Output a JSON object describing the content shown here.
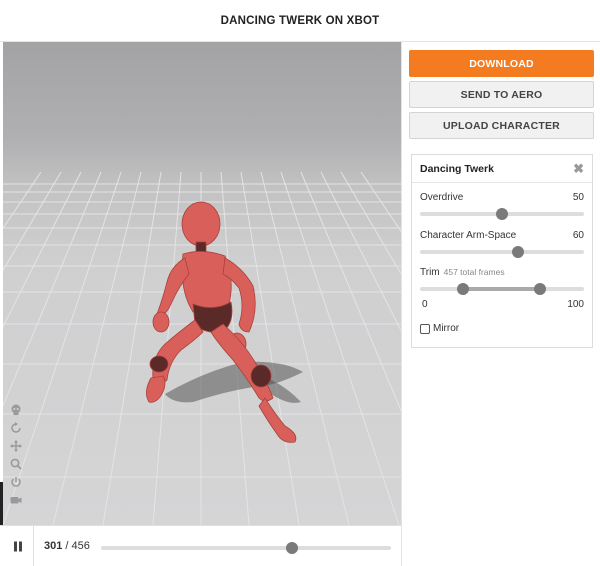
{
  "header": {
    "title": "DANCING TWERK ON XBOT"
  },
  "panel": {
    "download_label": "DOWNLOAD",
    "aero_label": "SEND TO AERO",
    "upload_label": "UPLOAD CHARACTER",
    "card": {
      "title": "Dancing Twerk",
      "close_icon": "close-icon",
      "overdrive": {
        "label": "Overdrive",
        "value": "50",
        "fraction": 0.5
      },
      "arm_space": {
        "label": "Character Arm-Space",
        "value": "60",
        "fraction": 0.6
      },
      "trim": {
        "label": "Trim",
        "sublabel": "457 total frames",
        "start": "0",
        "end": "100",
        "start_fraction": 0.26,
        "end_fraction": 0.73
      },
      "mirror": {
        "label": "Mirror",
        "checked": false
      }
    }
  },
  "timeline": {
    "current_frame": "301",
    "separator": " / ",
    "total_frames": "456",
    "progress": 0.66
  },
  "viewport": {
    "tools": [
      "skull-icon",
      "rotate-icon",
      "move-icon",
      "zoom-icon",
      "power-icon",
      "camera-icon"
    ]
  },
  "colors": {
    "accent": "#f47b20",
    "character": "#d9605a"
  }
}
